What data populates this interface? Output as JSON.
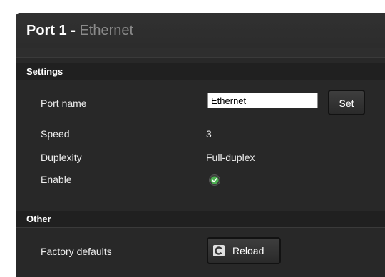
{
  "header": {
    "port_label": "Port 1",
    "separator": " - ",
    "port_type": "Ethernet"
  },
  "sections": {
    "settings_title": "Settings",
    "other_title": "Other"
  },
  "settings": {
    "port_name_label": "Port name",
    "port_name_value": "Ethernet",
    "set_button_label": "Set",
    "speed_label": "Speed",
    "speed_value": "3",
    "duplexity_label": "Duplexity",
    "duplexity_value": "Full-duplex",
    "enable_label": "Enable",
    "enable_state": true
  },
  "other": {
    "factory_defaults_label": "Factory defaults",
    "reload_button_label": "Reload"
  },
  "icons": {
    "enable": "check-circle-icon",
    "reload": "reload-icon"
  },
  "colors": {
    "panel_bg": "#2e2e2e",
    "section_bar": "#202020",
    "enabled_green": "#4caf50",
    "muted_title": "#8a8a8a"
  }
}
